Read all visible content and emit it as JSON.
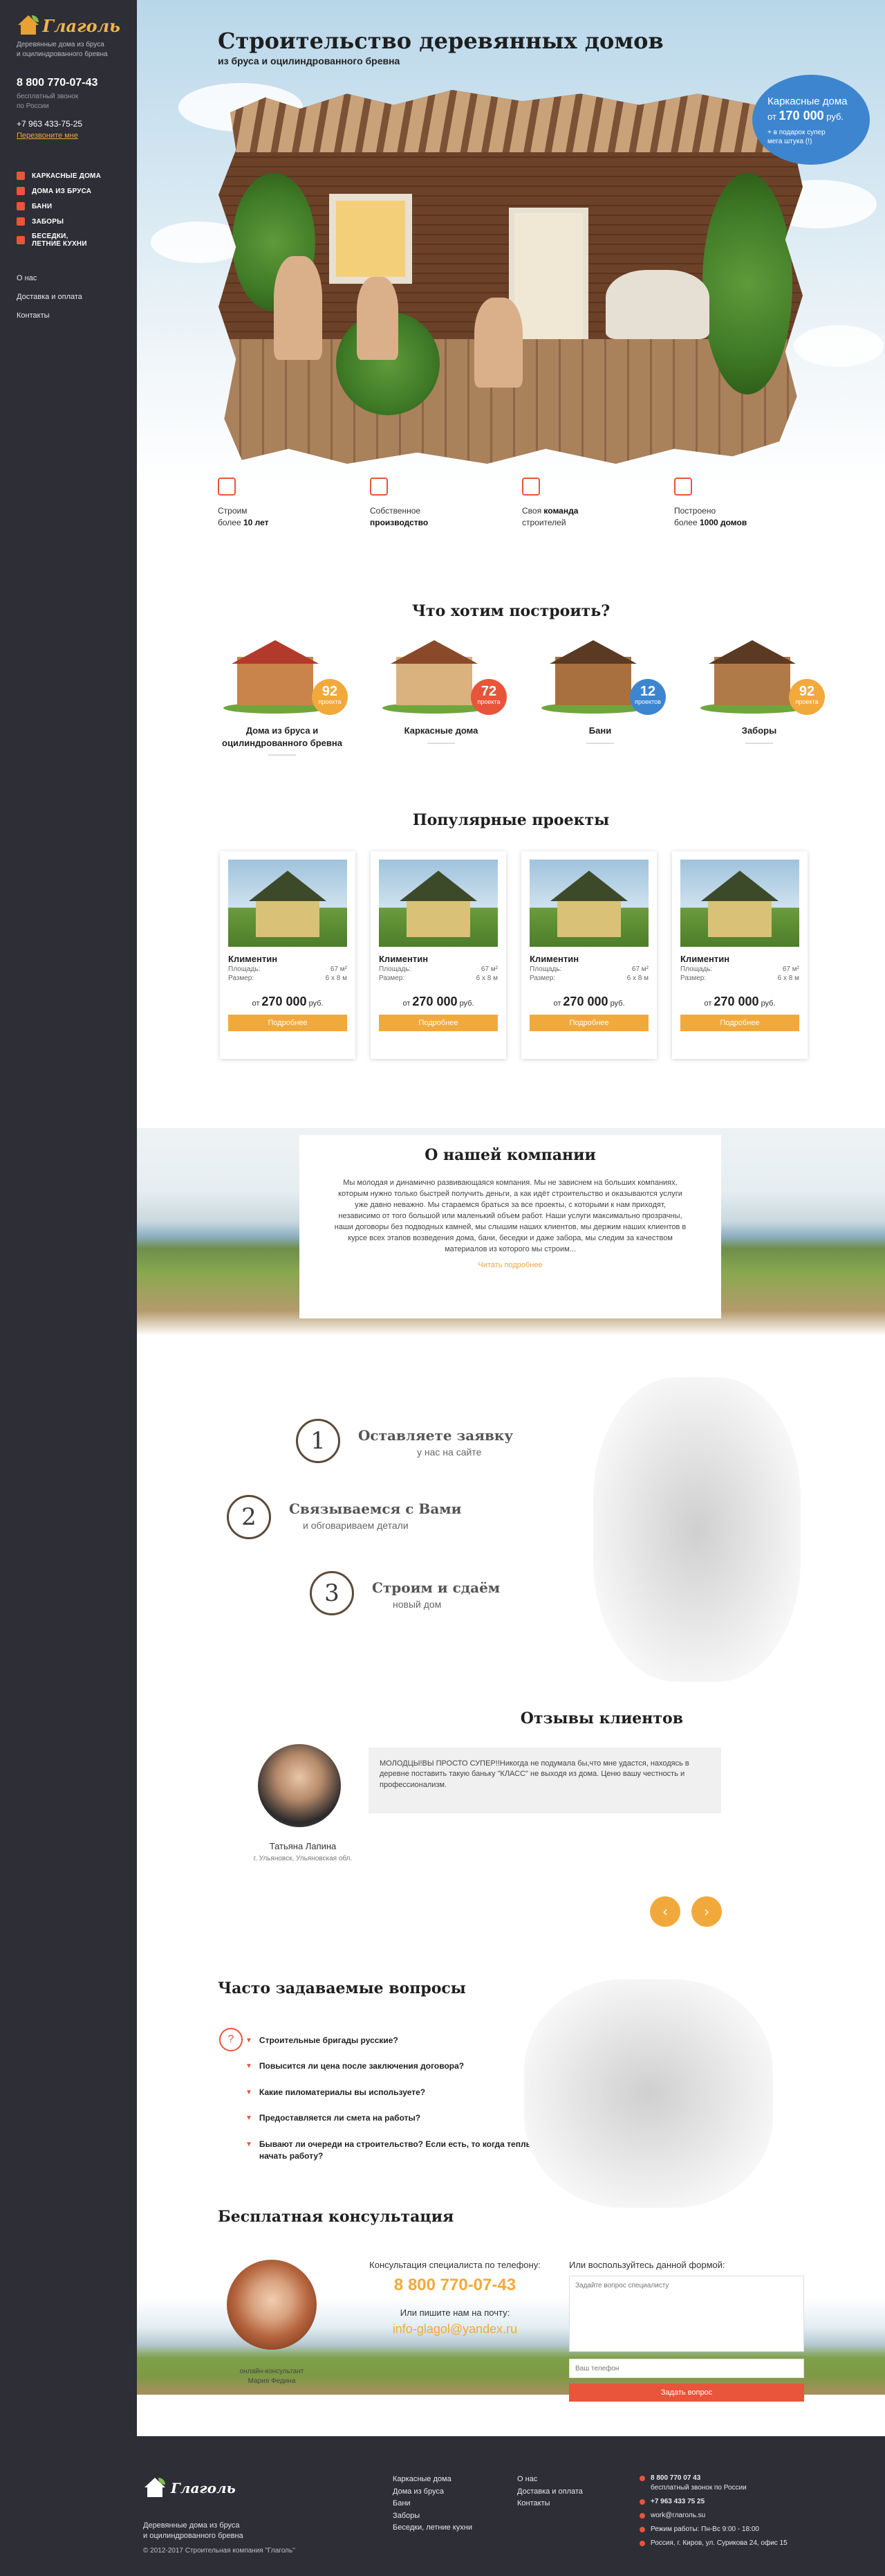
{
  "sidebar": {
    "logo_text": "Глаголь",
    "tagline": "Деревянные дома из бруса\nи оцилиндрованного бревна",
    "phone_main": "8 800 770-07-43",
    "phone_note": "бесплатный звонок\nпо России",
    "phone_secondary": "+7 963 433-75-25",
    "callback_link": "Перезвоните мне",
    "categories": [
      {
        "label": "КАРКАСНЫЕ ДОМА"
      },
      {
        "label": "ДОМА ИЗ БРУСА"
      },
      {
        "label": "БАНИ"
      },
      {
        "label": "ЗАБОРЫ"
      },
      {
        "label": "БЕСЕДКИ,\nЛЕТНИЕ КУХНИ"
      }
    ],
    "info_links": [
      {
        "label": "О нас"
      },
      {
        "label": "Доставка и оплата"
      },
      {
        "label": "Контакты"
      }
    ]
  },
  "hero": {
    "title": "Строительство деревянных домов",
    "subtitle": "из бруса и оцилиндрованного бревна",
    "badge_line1": "Каркасные дома",
    "badge_line2_prefix": "от",
    "badge_price": "170 000",
    "badge_line2_suffix": "руб.",
    "badge_line3": "+ в подарок супер\nмега штука (!)"
  },
  "features": [
    {
      "text": "Строим\nболее ",
      "bold": "10 лет",
      "icon": "helmet-icon"
    },
    {
      "text": "Собственное\n",
      "bold": "производство",
      "icon": "factory-icon"
    },
    {
      "text": "Своя ",
      "bold": "команда",
      "text2": "\nстроителей",
      "icon": "team-icon"
    },
    {
      "text": "Построено\nболее ",
      "bold": "1000 домов",
      "icon": "house-icon"
    }
  ],
  "categories_section": {
    "title": "Что хотим построить?",
    "items": [
      {
        "name": "Дома из бруса и оцилиндрованного бревна",
        "count": "92",
        "count_label": "проекта",
        "color": "#f2a93b"
      },
      {
        "name": "Каркасные дома",
        "count": "72",
        "count_label": "проекта",
        "color": "#e8553a"
      },
      {
        "name": "Бани",
        "count": "12",
        "count_label": "проектов",
        "color": "#3d86cf"
      },
      {
        "name": "Заборы",
        "count": "92",
        "count_label": "проекта",
        "color": "#f2a93b"
      }
    ]
  },
  "projects_section": {
    "title": "Популярные проекты",
    "items": [
      {
        "name": "Климентин",
        "area_label": "Площадь:",
        "area": "67 м²",
        "size_label": "Размер:",
        "size": "6 х 8 м",
        "price_prefix": "от",
        "price": "270 000",
        "price_suffix": "руб.",
        "button": "Подробнее"
      },
      {
        "name": "Климентин",
        "area_label": "Площадь:",
        "area": "67 м²",
        "size_label": "Размер:",
        "size": "6 х 8 м",
        "price_prefix": "от",
        "price": "270 000",
        "price_suffix": "руб.",
        "button": "Подробнее"
      },
      {
        "name": "Климентин",
        "area_label": "Площадь:",
        "area": "67 м²",
        "size_label": "Размер:",
        "size": "6 х 8 м",
        "price_prefix": "от",
        "price": "270 000",
        "price_suffix": "руб.",
        "button": "Подробнее"
      },
      {
        "name": "Климентин",
        "area_label": "Площадь:",
        "area": "67 м²",
        "size_label": "Размер:",
        "size": "6 х 8 м",
        "price_prefix": "от",
        "price": "270 000",
        "price_suffix": "руб.",
        "button": "Подробнее"
      }
    ]
  },
  "about": {
    "title": "О нашей компании",
    "text": "Мы молодая и динамично развивающаяся компания. Мы не зависнем на больших компаниях, которым нужно только быстрей получить деньги, а как идёт строительство и оказываются услуги уже давно неважно. Мы стараемся браться за все проекты, с которыми к нам приходят, независимо от того большой или маленький объем работ. Наши услуги максимально прозрачны, наши договоры без подводных камней, мы слышим наших клиентов, мы держим наших клиентов в курсе всех этапов возведения дома, бани, беседки и даже забора, мы следим за качеством материалов из которого мы строим...",
    "more": "Читать подробнее"
  },
  "steps": [
    {
      "num": "1",
      "title": "Оставляете заявку",
      "sub": "у нас на сайте"
    },
    {
      "num": "2",
      "title": "Связываемся с Вами",
      "sub": "и обговариваем детали"
    },
    {
      "num": "3",
      "title": "Строим и сдаём",
      "sub": "новый дом"
    }
  ],
  "reviews": {
    "title": "Отзывы клиентов",
    "name": "Татьяна Лапина",
    "city": "г. Ульяновск, Ульяновская обл.",
    "text": "МОЛОДЦЫ!ВЫ ПРОСТО СУПЕР!!Никогда не подумала бы,что мне удастся, находясь в деревне поставить такую баньку \"КЛАСС\" не выходя из дома. Ценю вашу честность и профессионализм.",
    "prev": "‹",
    "next": "›"
  },
  "faq": {
    "title": "Часто задаваемые вопросы",
    "icon": "?",
    "items": [
      {
        "q": "Строительные бригады русские?"
      },
      {
        "q": "Повысится ли цена после заключения договора?"
      },
      {
        "q": "Какие пиломатериалы вы используете?"
      },
      {
        "q": "Предоставляется ли смета на работы?"
      },
      {
        "q": "Бывают ли очереди на строительство? Если есть, то когда теплы начать работу?"
      }
    ]
  },
  "consult": {
    "title": "Бесплатная консультация",
    "manager_role": "онлайн-консультант\nМария Федина",
    "phone_label": "Консультация специалиста по телефону:",
    "phone": "8 800 770-07-43",
    "email_label": "Или пишите нам на почту:",
    "email": "info-glagol@yandex.ru",
    "form_label": "Или воспользуйтесь данной формой:",
    "question_placeholder": "Задайте вопрос специалисту",
    "phone_placeholder": "Ваш телефон",
    "submit": "Задать вопрос"
  },
  "footer": {
    "logo_text": "Глаголь",
    "tagline": "Деревянные дома из бруса\nи оцилиндрованного бревна",
    "copyright": "© 2012-2017 Строительная компания \"Глаголь\"",
    "col1": [
      {
        "label": "Каркасные дома"
      },
      {
        "label": "Дома из бруса"
      },
      {
        "label": "Бани"
      },
      {
        "label": "Заборы"
      },
      {
        "label": "Беседки, летние кухни"
      }
    ],
    "col2": [
      {
        "label": "О нас"
      },
      {
        "label": "Доставка и оплата"
      },
      {
        "label": "Контакты"
      }
    ],
    "contacts": [
      {
        "label": "8 800 770 07 43",
        "sub": "бесплатный звонок по России"
      },
      {
        "label": "+7 963 433 75 25",
        "sub": ""
      },
      {
        "label": "work@глаголь.su",
        "sub": ""
      },
      {
        "label": "Режим работы: Пн-Вс 9:00 - 18:00",
        "sub": ""
      },
      {
        "label": "Россия, г. Киров, ул. Сурикова 24, офис 15",
        "sub": ""
      }
    ]
  }
}
